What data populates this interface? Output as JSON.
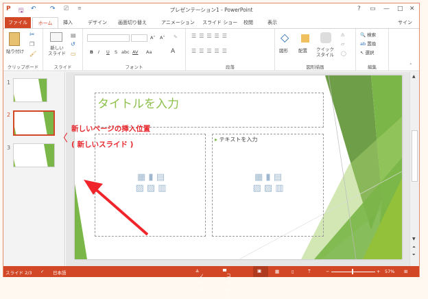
{
  "app": {
    "title": "プレゼンテーション1 - PowerPoint",
    "sign_in": "サインイン"
  },
  "window_controls": {
    "help": "?",
    "restore_ribbon": "▭",
    "minimize": "—",
    "maximize": "□",
    "close": "✕"
  },
  "tabs": [
    {
      "label": "ファイル"
    },
    {
      "label": "ホーム",
      "selected": true
    },
    {
      "label": "挿入"
    },
    {
      "label": "デザイン"
    },
    {
      "label": "画面切り替え"
    },
    {
      "label": "アニメーション"
    },
    {
      "label": "スライド ショー"
    },
    {
      "label": "校閲"
    },
    {
      "label": "表示"
    }
  ],
  "ribbon": {
    "clipboard": {
      "label": "クリップボード",
      "paste": "貼り付け"
    },
    "slides": {
      "label": "スライド",
      "new_slide_1": "新しい",
      "new_slide_2": "スライド"
    },
    "font": {
      "label": "フォント",
      "bold": "B",
      "italic": "I",
      "underline": "U",
      "shadow": "S",
      "strike": "abc",
      "spacing": "AV",
      "case": "Aa",
      "color": "A",
      "grow": "A˄",
      "shrink": "A˅"
    },
    "paragraph": {
      "label": "段落"
    },
    "drawing": {
      "label": "図形描画",
      "shapes": "図形",
      "arrange": "配置",
      "quick_1": "クイック",
      "quick_2": "スタイル"
    },
    "editing": {
      "label": "編集",
      "find": "検索",
      "replace": "置換",
      "select": "選択"
    }
  },
  "thumbnails": [
    {
      "number": "1"
    },
    {
      "number": "2",
      "selected": true
    },
    {
      "number": "3"
    }
  ],
  "slide": {
    "title_placeholder": "タイトルを入力",
    "text_placeholder": "テキストを入力"
  },
  "annotation": {
    "line1": "新しいページの挿入位置",
    "line2": "( 新しいスライド )"
  },
  "status": {
    "slide": "スライド 2/3",
    "language": "日本語",
    "notes": "ノート",
    "comments": "コメント",
    "zoom": "57%",
    "zoom_level": 57
  },
  "colors": {
    "accent": "#d24726",
    "slide_green": "#7ab648",
    "annotation": "#e8262c"
  }
}
